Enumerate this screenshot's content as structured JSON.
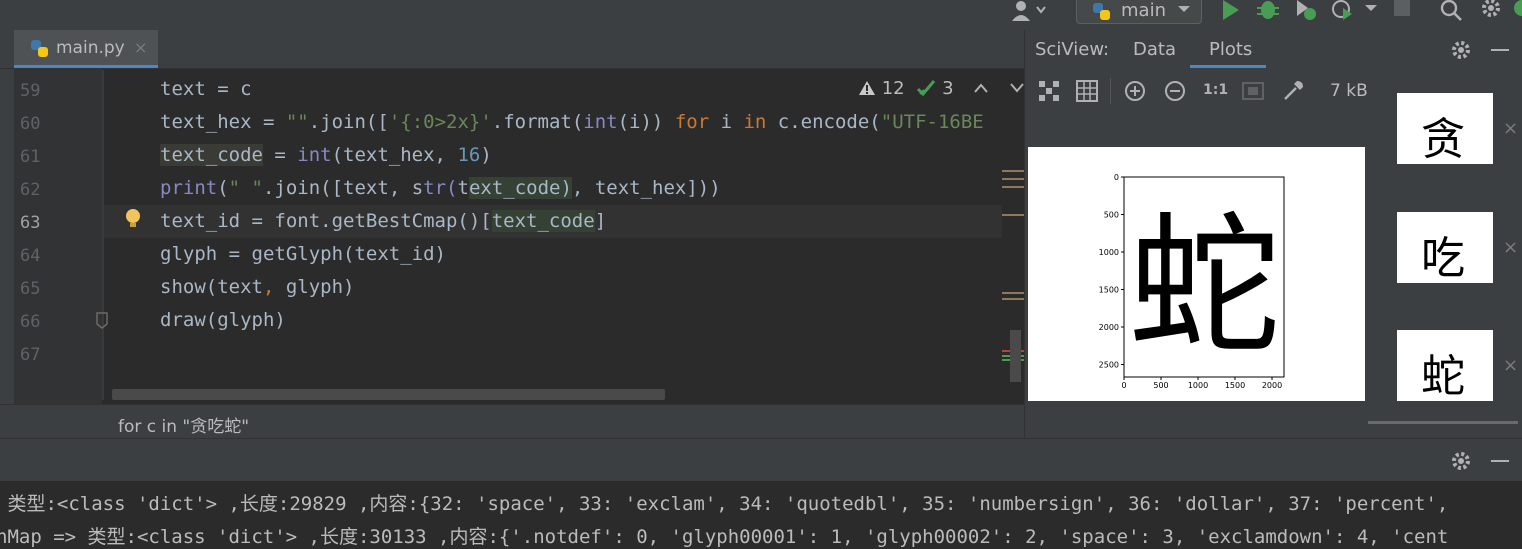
{
  "toolbar": {
    "branch": "main"
  },
  "editor": {
    "tab_name": "main.py",
    "tab_close": "×",
    "inspections": {
      "warnings": "12",
      "ok": "3"
    },
    "lines": [
      {
        "no": "59",
        "text": "text = c"
      },
      {
        "no": "60",
        "text": "text_hex = \"\".join(['{:0>2x}'.format(int(i)) for i in c.encode(\"UTF-16BE"
      },
      {
        "no": "61",
        "text": "text_code = int(text_hex, 16)"
      },
      {
        "no": "62",
        "text": "print(\" \".join([text, str(text_code), text_hex]))"
      },
      {
        "no": "63",
        "text": "text_id = font.getBestCmap()[text_code]"
      },
      {
        "no": "64",
        "text": "glyph = getGlyph(text_id)"
      },
      {
        "no": "65",
        "text": "show(text, glyph)"
      },
      {
        "no": "66",
        "text": "draw(glyph)"
      },
      {
        "no": "67",
        "text": ""
      }
    ],
    "breadcrumb": "for c in \"贪吃蛇\""
  },
  "sciview": {
    "label": "SciView:",
    "tabs": [
      "Data",
      "Plots"
    ],
    "active_tab": "Plots",
    "zoom_label": "1:1",
    "size": "7 kB",
    "plot": {
      "glyph": "蛇",
      "y_ticks": [
        "0",
        "500",
        "1000",
        "1500",
        "2000",
        "2500"
      ],
      "x_ticks": [
        "0",
        "500",
        "1000",
        "1500",
        "2000"
      ]
    },
    "thumbnails": [
      {
        "glyph": "贪",
        "close": "×"
      },
      {
        "glyph": "吃",
        "close": "×"
      },
      {
        "glyph": "蛇",
        "close": "×"
      }
    ]
  },
  "console": {
    "lines": [
      " 类型:<class 'dict'> ,长度:29829 ,内容:{32: 'space', 33: 'exclam', 34: 'quotedbl', 35: 'numbersign', 36: 'dollar', 37: 'percent',",
      "nMap => 类型:<class 'dict'> ,长度:30133 ,内容:{'.notdef': 0, 'glyph00001': 1, 'glyph00002': 2, 'space': 3, 'exclamdown': 4, 'cent"
    ]
  },
  "colors": {
    "accent": "#4a88c7",
    "run_green": "#499c54",
    "keyword": "#cc7832",
    "number": "#6897bb",
    "string": "#6a8759"
  }
}
